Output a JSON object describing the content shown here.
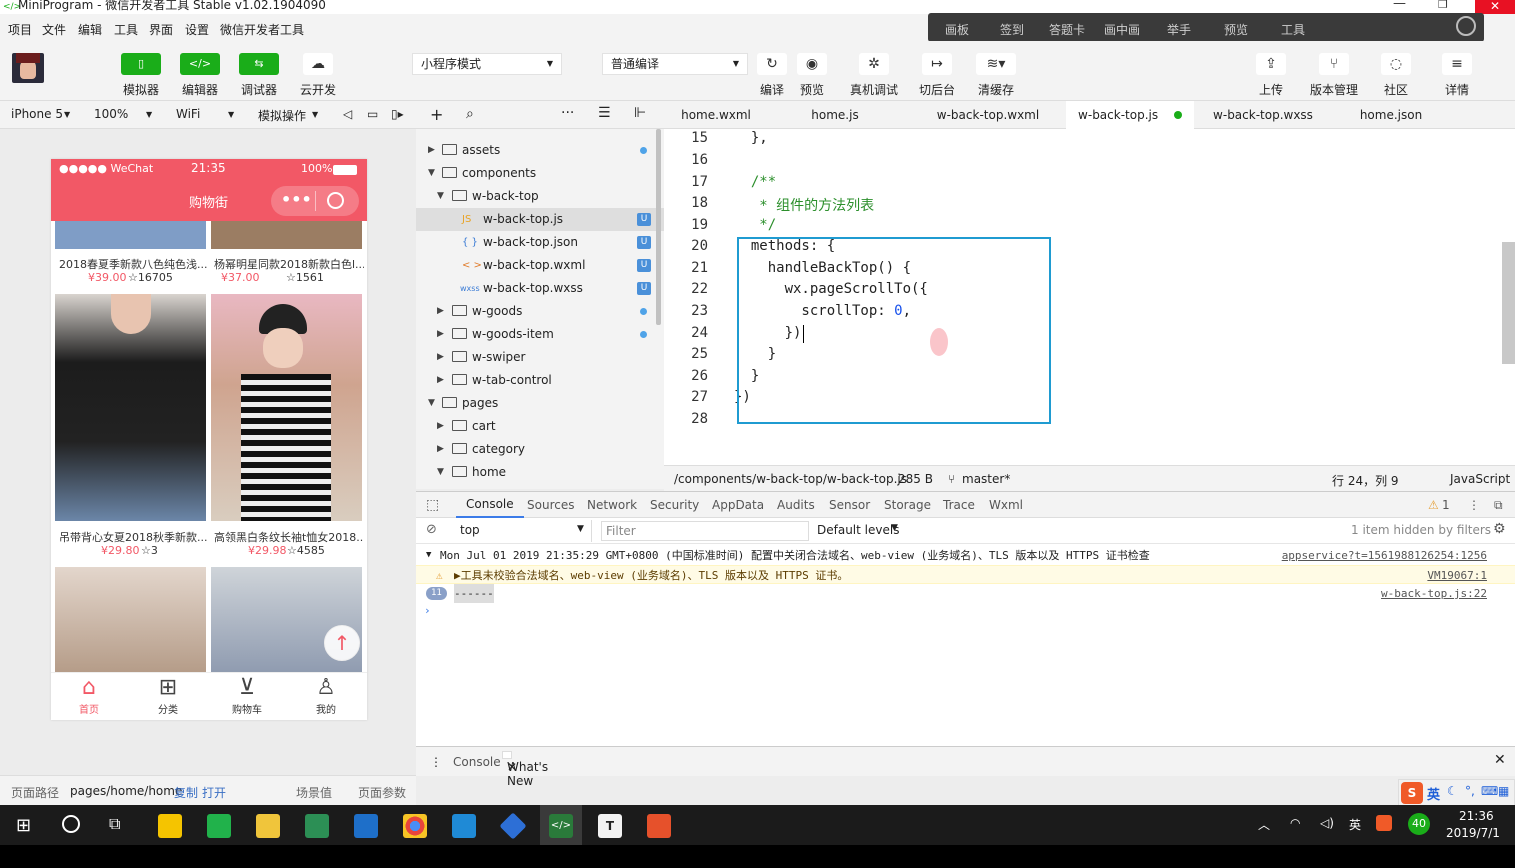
{
  "window": {
    "title": "MiniProgram - 微信开发者工具 Stable v1.02.1904090"
  },
  "menu": [
    "项目",
    "文件",
    "编辑",
    "工具",
    "界面",
    "设置",
    "微信开发者工具"
  ],
  "overlay": [
    "画板",
    "签到",
    "答题卡",
    "画中画",
    "举手",
    "预览",
    "工具"
  ],
  "toolbar": {
    "simulator": "模拟器",
    "editor": "编辑器",
    "debugger": "调试器",
    "cloud": "云开发",
    "mode": "小程序模式",
    "compile_mode": "普通编译",
    "compile": "编译",
    "preview": "预览",
    "remote_debug": "真机调试",
    "background": "切后台",
    "clear_cache": "清缓存",
    "upload": "上传",
    "version": "版本管理",
    "community": "社区",
    "details": "详情"
  },
  "simtoolbar": {
    "device": "iPhone 5",
    "zoom": "100%",
    "network": "WiFi",
    "operation": "模拟操作"
  },
  "phone": {
    "carrier": "●●●●● WeChat",
    "time": "21:35",
    "battery": "100%",
    "nav_title": "购物街",
    "products": [
      {
        "title": "2018春夏季新款八色纯色浅...",
        "price": "¥39.00",
        "fav": "☆16705"
      },
      {
        "title": "杨幂明星同款2018新款白色l...",
        "price": "¥37.00",
        "fav": "☆1561"
      },
      {
        "title": "吊带背心女夏2018秋季新款...",
        "price": "¥29.80",
        "fav": "☆3"
      },
      {
        "title": "高领黑白条纹长袖t恤女2018...",
        "price": "¥29.98",
        "fav": "☆4585"
      }
    ],
    "tabs": [
      "首页",
      "分类",
      "购物车",
      "我的"
    ]
  },
  "simbottom": {
    "path_label": "页面路径",
    "path": "pages/home/home",
    "copy": "复制",
    "open": "打开",
    "scene": "场景值",
    "params": "页面参数"
  },
  "tree": {
    "assets": "assets",
    "components": "components",
    "wbacktop": "w-back-top",
    "f_js": "w-back-top.js",
    "f_json": "w-back-top.json",
    "f_wxml": "w-back-top.wxml",
    "f_wxss": "w-back-top.wxss",
    "wgoods": "w-goods",
    "wgoodsitem": "w-goods-item",
    "wswiper": "w-swiper",
    "wtab": "w-tab-control",
    "pages": "pages",
    "cart": "cart",
    "category": "category",
    "home": "home",
    "badge": "U",
    "js_icon": "JS",
    "json_icon": "{ }",
    "wxml_icon": "< >",
    "wxss_icon": "wxss"
  },
  "editor_tabs": [
    "home.wxml",
    "home.js",
    "w-back-top.wxml",
    "w-back-top.js",
    "w-back-top.wxss",
    "home.json"
  ],
  "code": {
    "lines": [
      "15",
      "16",
      "17",
      "18",
      "19",
      "20",
      "21",
      "22",
      "23",
      "24",
      "25",
      "26",
      "27",
      "28"
    ],
    "l15": "  },",
    "l17": "  /**",
    "l18": "   * 组件的方法列表",
    "l19": "   */",
    "l20": "  methods: {",
    "l21": "    handleBackTop() {",
    "l22": "      wx.pageScrollTo({",
    "l23a": "        scrollTop: ",
    "l23b": "0",
    "l23c": ",",
    "l24": "      })",
    "l25": "    }",
    "l26": "  }",
    "l27": "})"
  },
  "edstatus": {
    "path": "/components/w-back-top/w-back-top.js",
    "size": "285 B",
    "branch": "master*",
    "pos": "行 24，列 9",
    "lang": "JavaScript"
  },
  "devtools": {
    "tabs": [
      "Console",
      "Sources",
      "Network",
      "Security",
      "AppData",
      "Audits",
      "Sensor",
      "Storage",
      "Trace",
      "Wxml"
    ],
    "warn_count": "1",
    "context": "top",
    "filter_placeholder": "Filter",
    "levels": "Default levels",
    "hidden": "1 item hidden by filters",
    "log1": "Mon Jul 01 2019 21:35:29 GMT+0800 (中国标准时间) 配置中关闭合法域名、web-view (业务域名)、TLS 版本以及 HTTPS 证书检查",
    "log1_src": "appservice?t=1561988126254:1256",
    "log2": "▶工具未校验合法域名、web-view (业务域名)、TLS 版本以及 HTTPS 证书。",
    "log2_src": "VM19067:1",
    "log3_count": "11",
    "log3": "------",
    "log3_src": "w-back-top.js:22",
    "drawer_console": "Console",
    "drawer_whatsnew": "What's New"
  },
  "ime": {
    "lang": "英"
  },
  "taskbar": {
    "time": "21:36",
    "date": "2019/7/1",
    "ime": "英",
    "badge": "40"
  }
}
